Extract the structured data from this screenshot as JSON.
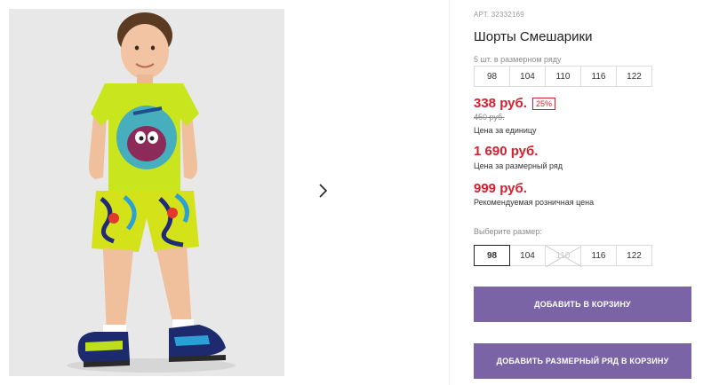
{
  "product": {
    "sku": "АРТ. 32332169",
    "title": "Шорты Смешарики",
    "pack_label": "5 шт. в размерном ряду",
    "pack_sizes": [
      "98",
      "104",
      "110",
      "116",
      "122"
    ],
    "price": "338 руб.",
    "discount": "25%",
    "old_price": "450 руб.",
    "unit_price_label": "Цена за единицу",
    "pack_price": "1 690 руб.",
    "pack_price_label": "Цена за размерный ряд",
    "rrp": "999 руб.",
    "rrp_label": "Рекомендуемая розничная цена",
    "choose_size_label": "Выберите размер:",
    "size_options": [
      {
        "label": "98",
        "state": "selected"
      },
      {
        "label": "104",
        "state": "available"
      },
      {
        "label": "110",
        "state": "disabled"
      },
      {
        "label": "116",
        "state": "available"
      },
      {
        "label": "122",
        "state": "available"
      }
    ],
    "add_to_cart": "ДОБАВИТЬ В КОРЗИНУ",
    "add_pack_to_cart": "ДОБАВИТЬ РАЗМЕРНЫЙ РЯД В КОРЗИНУ"
  },
  "gallery": {
    "next_icon": "chevron-right-icon",
    "photo": "child-model-photo"
  },
  "colors": {
    "accent_red": "#d5202e",
    "button_purple": "#7b64a6",
    "tshirt_lime": "#c8e51e"
  }
}
